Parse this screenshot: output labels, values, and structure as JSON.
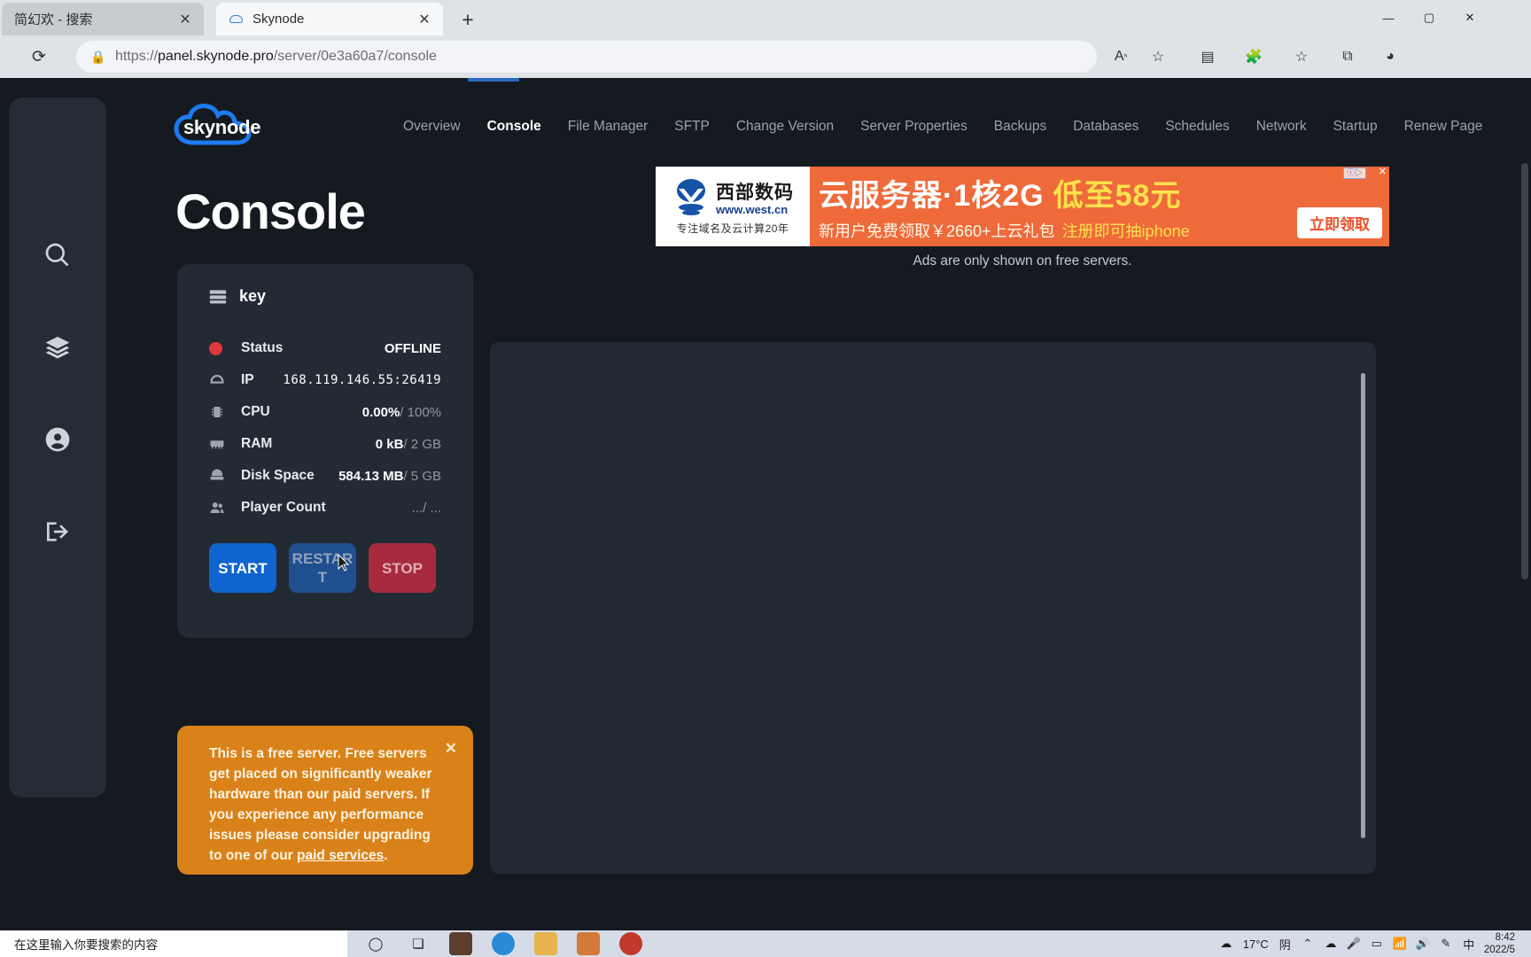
{
  "browser": {
    "tabs": [
      {
        "title": "简幻欢 - 搜索",
        "active": false,
        "close_label": "✕"
      },
      {
        "title": "Skynode",
        "active": true,
        "close_label": "✕"
      }
    ],
    "new_tab_label": "+",
    "window_controls": {
      "minimize": "—",
      "maximize": "▢",
      "close": "✕"
    },
    "nav": {
      "reload": "⟳",
      "back": "‹",
      "forward": "›"
    },
    "url": {
      "scheme": "https://",
      "host": "panel.skynode.pro",
      "path": "/server/0e3a60a7/console",
      "lock_icon": "lock-icon"
    },
    "toolbar_icons": [
      "read-aloud-icon",
      "add-favorite-icon",
      "split-screen-icon",
      "extensions-icon",
      "favorites-icon",
      "collections-icon",
      "profile-icon"
    ]
  },
  "sidebar": {
    "items": [
      {
        "name": "search",
        "icon": "search-icon"
      },
      {
        "name": "servers",
        "icon": "layers-icon"
      },
      {
        "name": "account",
        "icon": "user-circle-icon"
      },
      {
        "name": "logout",
        "icon": "logout-icon"
      }
    ]
  },
  "header": {
    "logo_text": "skynode",
    "nav": [
      {
        "label": "Overview",
        "active": false
      },
      {
        "label": "Console",
        "active": true
      },
      {
        "label": "File Manager",
        "active": false
      },
      {
        "label": "SFTP",
        "active": false
      },
      {
        "label": "Change Version",
        "active": false
      },
      {
        "label": "Server Properties",
        "active": false
      },
      {
        "label": "Backups",
        "active": false
      },
      {
        "label": "Databases",
        "active": false
      },
      {
        "label": "Schedules",
        "active": false
      },
      {
        "label": "Network",
        "active": false
      },
      {
        "label": "Startup",
        "active": false
      },
      {
        "label": "Renew Page",
        "active": false
      }
    ]
  },
  "page_title": "Console",
  "ad": {
    "brand_name": "西部数码",
    "brand_url": "www.west.cn",
    "brand_tagline": "专注域名及云计算20年",
    "headline": "云服务器·1核2G",
    "headline_highlight": "低至58元",
    "sub_left": "新用户免费领取￥2660+上云礼包",
    "sub_right": "注册即可抽iphone",
    "cta": "立即领取",
    "badge": "ⓘ▷",
    "close": "✕",
    "note": "Ads are only shown on free servers."
  },
  "server_card": {
    "title": "key",
    "title_icon": "server-icon",
    "stats": [
      {
        "label": "Status",
        "icon": "status-dot-icon",
        "value": "OFFLINE",
        "max": "",
        "mono": false
      },
      {
        "label": "IP",
        "icon": "network-icon",
        "value": "168.119.146.55:26419",
        "max": "",
        "mono": true
      },
      {
        "label": "CPU",
        "icon": "cpu-icon",
        "value": "0.00%",
        "max": "/ 100%",
        "mono": false
      },
      {
        "label": "RAM",
        "icon": "ram-icon",
        "value": "0 kB",
        "max": "/ 2 GB",
        "mono": false
      },
      {
        "label": "Disk Space",
        "icon": "disk-icon",
        "value": "584.13 MB",
        "max": "/ 5 GB",
        "mono": false
      },
      {
        "label": "Player Count",
        "icon": "players-icon",
        "value": "...",
        "max": "/ ...",
        "mono": false
      }
    ],
    "buttons": [
      {
        "label": "START",
        "kind": "start"
      },
      {
        "label": "RESTART",
        "kind": "restart"
      },
      {
        "label": "STOP",
        "kind": "stop"
      }
    ]
  },
  "notice": {
    "text_before_link": "This is a free server. Free servers get placed on significantly weaker hardware than our paid servers. If you experience any performance issues please consider upgrading to one of our ",
    "link": "paid services",
    "text_after_link": ".",
    "close": "✕"
  },
  "taskbar": {
    "search_placeholder": "在这里输入你要搜索的内容",
    "cortana_icon": "circle-icon",
    "taskview_icon": "task-view-icon",
    "apps": [
      "store-icon",
      "edge-icon",
      "explorer-icon",
      "game-icon",
      "record-icon"
    ],
    "tray": {
      "weather_temp": "17°C",
      "weather_desc": "阴",
      "icons": [
        "chevron-up-icon",
        "cloud-icon",
        "mic-icon",
        "battery-icon",
        "wifi-icon",
        "volume-icon",
        "pen-icon"
      ],
      "ime": "中",
      "time": "8:42",
      "date": "2022/5"
    }
  },
  "colors": {
    "page_bg": "#151a21",
    "card_bg": "#222a34",
    "accent_blue": "#1064cf",
    "notice_orange": "#d9821a",
    "status_red": "#e0383e",
    "ad_orange": "#ee6a3a"
  }
}
